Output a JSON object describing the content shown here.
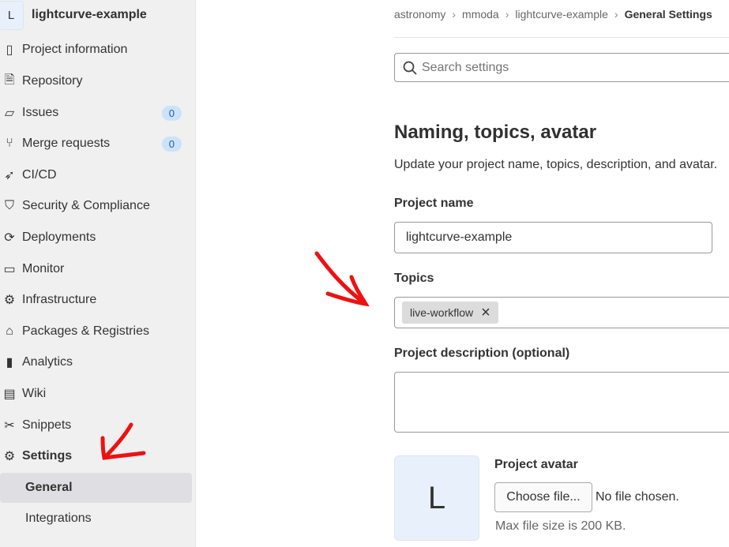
{
  "sidebar": {
    "project_avatar": "L",
    "project_name": "lightcurve-example",
    "items": [
      {
        "label": "Project information",
        "icon": "project-icon"
      },
      {
        "label": "Repository",
        "icon": "document-icon"
      },
      {
        "label": "Issues",
        "icon": "issues-icon",
        "badge": "0"
      },
      {
        "label": "Merge requests",
        "icon": "merge-request-icon",
        "badge": "0"
      },
      {
        "label": "CI/CD",
        "icon": "rocket-icon"
      },
      {
        "label": "Security & Compliance",
        "icon": "shield-icon"
      },
      {
        "label": "Deployments",
        "icon": "deployments-icon"
      },
      {
        "label": "Monitor",
        "icon": "monitor-icon"
      },
      {
        "label": "Infrastructure",
        "icon": "cloud-gear-icon"
      },
      {
        "label": "Packages & Registries",
        "icon": "package-icon"
      },
      {
        "label": "Analytics",
        "icon": "chart-icon"
      },
      {
        "label": "Wiki",
        "icon": "book-icon"
      },
      {
        "label": "Snippets",
        "icon": "scissors-icon"
      },
      {
        "label": "Settings",
        "icon": "gear-icon"
      },
      {
        "label": "General"
      },
      {
        "label": "Integrations"
      }
    ]
  },
  "breadcrumb": [
    "astronomy",
    "mmoda",
    "lightcurve-example",
    "General Settings"
  ],
  "search": {
    "placeholder": "Search settings"
  },
  "section": {
    "title": "Naming, topics, avatar",
    "description": "Update your project name, topics, description, and avatar."
  },
  "form": {
    "project_name_label": "Project name",
    "project_name_value": "lightcurve-example",
    "topics_label": "Topics",
    "topics": [
      "live-workflow"
    ],
    "description_label": "Project description (optional)",
    "description_value": "",
    "avatar_label": "Project avatar",
    "avatar_letter": "L",
    "choose_file": "Choose file...",
    "no_file": "No file chosen.",
    "max_size": "Max file size is 200 KB."
  },
  "annotation_color": "#ee1111"
}
